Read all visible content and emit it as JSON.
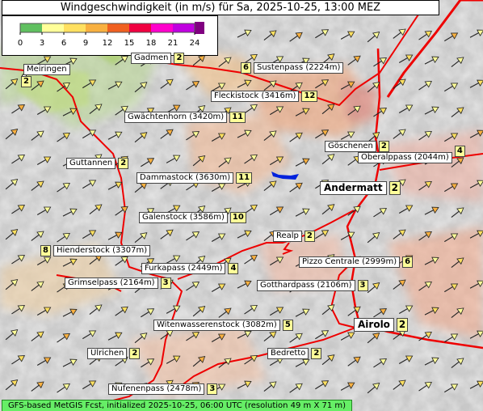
{
  "title": "Windgeschwindigkeit (in m/s) für Sa, 2025-10-25, 13:00 MEZ",
  "legend": {
    "ticks": [
      "0",
      "3",
      "6",
      "9",
      "12",
      "15",
      "18",
      "21",
      "24"
    ],
    "colors": [
      "#60c060",
      "#ffff99",
      "#ffe060",
      "#f8b040",
      "#f06020",
      "#f00040",
      "#ff00cc",
      "#c000e0",
      "#800080"
    ]
  },
  "footer": "GFS-based MetGIS Fcst, initialized 2025-10-25, 06:00 UTC  (resolution 49 m X 71 m)",
  "locations": [
    {
      "name": "Gadmen",
      "value": "2"
    },
    {
      "name": "Meiringen",
      "value": "2"
    },
    {
      "name": "Sustenpass (2224m)",
      "value": "6"
    },
    {
      "name": "Fleckistock (3416m)",
      "value": "12"
    },
    {
      "name": "Gwächtenhorn (3420m)",
      "value": "11"
    },
    {
      "name": "Göschenen",
      "value": "2"
    },
    {
      "name": "Guttannen",
      "value": "2"
    },
    {
      "name": "Oberalppass (2044m)",
      "value": "4"
    },
    {
      "name": "Dammastock (3630m)",
      "value": "11"
    },
    {
      "name": "Andermatt",
      "value": "2"
    },
    {
      "name": "Galenstock (3586m)",
      "value": "10"
    },
    {
      "name": "Realp",
      "value": "2"
    },
    {
      "name": "Hienderstock (3307m)",
      "value": "8"
    },
    {
      "name": "Pizzo Centrale (2999m)",
      "value": "6"
    },
    {
      "name": "Furkapass (2449m)",
      "value": "4"
    },
    {
      "name": "Grimselpass (2164m)",
      "value": "3"
    },
    {
      "name": "Gotthardpass (2106m)",
      "value": "3"
    },
    {
      "name": "Airolo",
      "value": "2"
    },
    {
      "name": "Witenwasserenstock (3082m)",
      "value": "5"
    },
    {
      "name": "Ulrichen",
      "value": "2"
    },
    {
      "name": "Bedretto",
      "value": "2"
    },
    {
      "name": "Nufenenpass (2478m)",
      "value": "3"
    }
  ]
}
